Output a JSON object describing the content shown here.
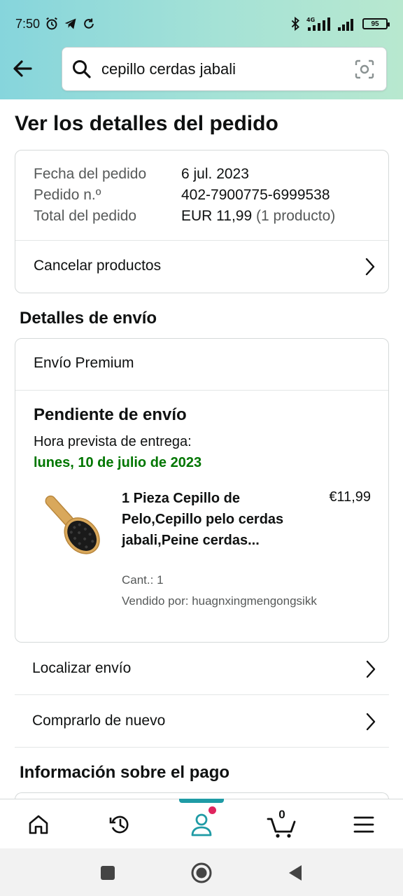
{
  "status_bar": {
    "time": "7:50",
    "network": "4G",
    "battery": "95"
  },
  "search": {
    "query": "cepillo cerdas jabali"
  },
  "page_title": "Ver los detalles del pedido",
  "order_summary": {
    "date_label": "Fecha del pedido",
    "date_value": "6 jul. 2023",
    "number_label": "Pedido n.º",
    "number_value": "402-7900775-6999538",
    "total_label": "Total del pedido",
    "total_value": "EUR 11,99",
    "total_count": "(1 producto)",
    "cancel_label": "Cancelar productos"
  },
  "shipping": {
    "section_title": "Detalles de envío",
    "method": "Envío Premium",
    "status": "Pendiente de envío",
    "eta_label": "Hora prevista de entrega:",
    "eta_date": "lunes, 10 de julio de 2023",
    "eta_color": "#007600",
    "product": {
      "title": "1 Pieza Cepillo de Pelo,Cepillo pelo cerdas jabali,Peine cerdas...",
      "price": "€11,99",
      "quantity": "Cant.: 1",
      "seller": "Vendido por: huagnxingmengongsikk"
    }
  },
  "actions": {
    "track": "Localizar envío",
    "buy_again": "Comprarlo de nuevo"
  },
  "payment": {
    "section_title": "Información sobre el pago"
  },
  "bottom_nav": {
    "items": [
      "home-icon",
      "history-icon",
      "account-icon",
      "cart-icon",
      "menu-icon"
    ],
    "cart_count": "0",
    "accent_color": "#1f9ba5"
  }
}
